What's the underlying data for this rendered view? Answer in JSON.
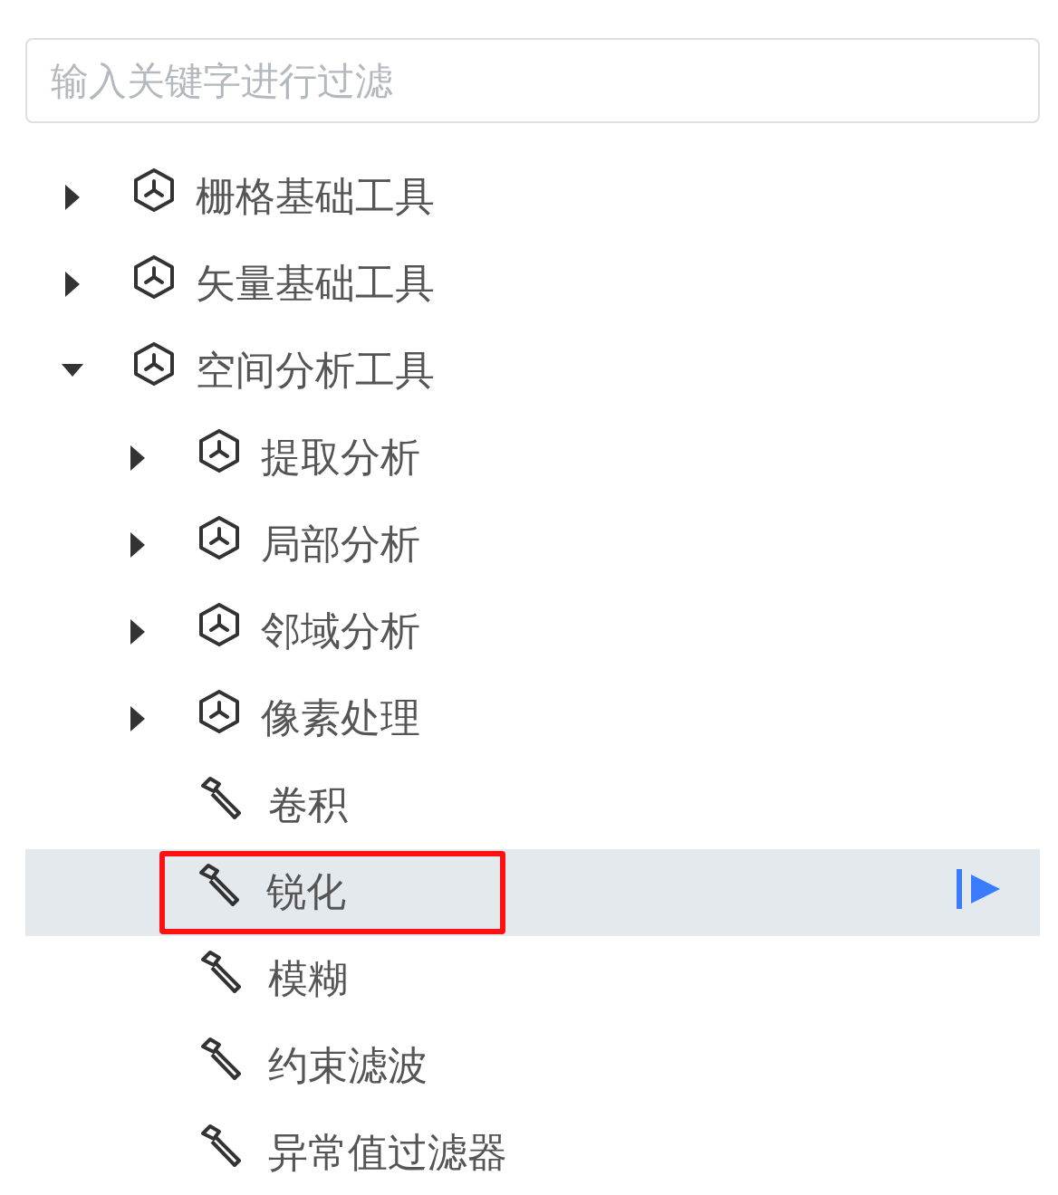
{
  "search": {
    "placeholder": "输入关键字进行过滤"
  },
  "tree": [
    {
      "label": "栅格基础工具",
      "kind": "folder",
      "expanded": false,
      "selected": false
    },
    {
      "label": "矢量基础工具",
      "kind": "folder",
      "expanded": false,
      "selected": false
    },
    {
      "label": "空间分析工具",
      "kind": "folder",
      "expanded": true,
      "selected": false,
      "children": [
        {
          "label": "提取分析",
          "kind": "folder",
          "expanded": false,
          "selected": false
        },
        {
          "label": "局部分析",
          "kind": "folder",
          "expanded": false,
          "selected": false
        },
        {
          "label": "邻域分析",
          "kind": "folder",
          "expanded": false,
          "selected": false
        },
        {
          "label": "像素处理",
          "kind": "folder",
          "expanded": false,
          "selected": false
        },
        {
          "label": "卷积",
          "kind": "tool",
          "selected": false,
          "highlighted": false
        },
        {
          "label": "锐化",
          "kind": "tool",
          "selected": true,
          "highlighted": true
        },
        {
          "label": "模糊",
          "kind": "tool",
          "selected": false,
          "highlighted": false
        },
        {
          "label": "约束滤波",
          "kind": "tool",
          "selected": false,
          "highlighted": false
        },
        {
          "label": "异常值过滤器",
          "kind": "tool",
          "selected": false,
          "highlighted": false
        }
      ]
    }
  ]
}
